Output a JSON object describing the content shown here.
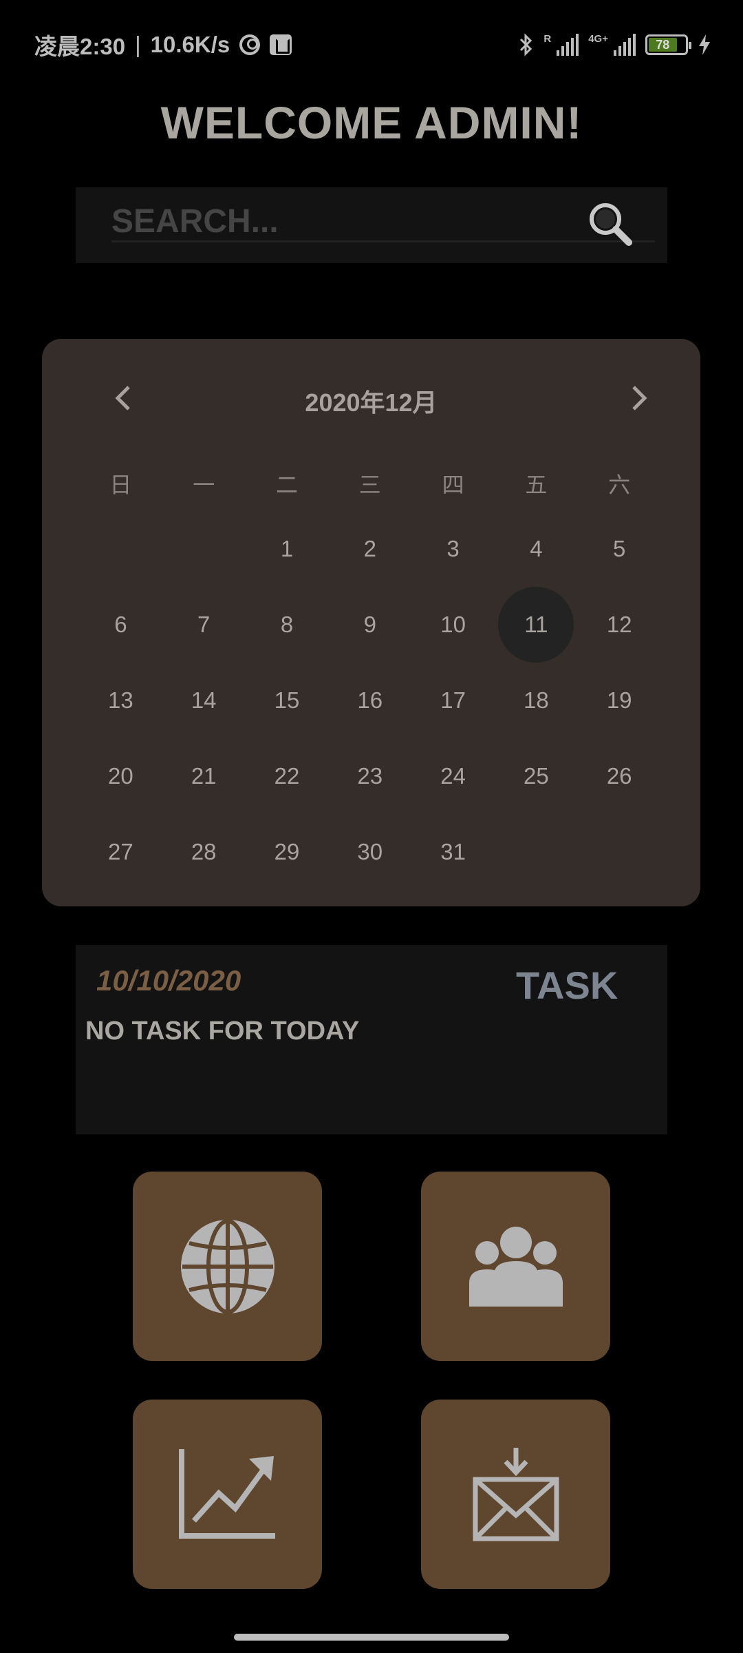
{
  "status": {
    "time": "凌晨2:30",
    "speed": "10.6K/s",
    "battery": "78",
    "battery_level": 0.78,
    "sim1_label": "R",
    "sim2_label": "4G+"
  },
  "header": {
    "title": "WELCOME ADMIN!"
  },
  "search": {
    "placeholder": "SEARCH..."
  },
  "calendar": {
    "title": "2020年12月",
    "weekdays": [
      "日",
      "一",
      "二",
      "三",
      "四",
      "五",
      "六"
    ],
    "weeks": [
      [
        "",
        "",
        "1",
        "2",
        "3",
        "4",
        "5"
      ],
      [
        "6",
        "7",
        "8",
        "9",
        "10",
        "11",
        "12"
      ],
      [
        "13",
        "14",
        "15",
        "16",
        "17",
        "18",
        "19"
      ],
      [
        "20",
        "21",
        "22",
        "23",
        "24",
        "25",
        "26"
      ],
      [
        "27",
        "28",
        "29",
        "30",
        "31",
        "",
        ""
      ]
    ],
    "selected_day": "11"
  },
  "task": {
    "date": "10/10/2020",
    "label": "TASK",
    "empty_text": "NO TASK FOR TODAY"
  },
  "tiles": [
    {
      "name": "globe-icon"
    },
    {
      "name": "users-icon"
    },
    {
      "name": "chart-trend-icon"
    },
    {
      "name": "mail-download-icon"
    }
  ],
  "colors": {
    "background": "#000000",
    "calendar_bg": "#342d29",
    "tile_bg": "#5e462f",
    "task_date": "#7a5f44"
  }
}
